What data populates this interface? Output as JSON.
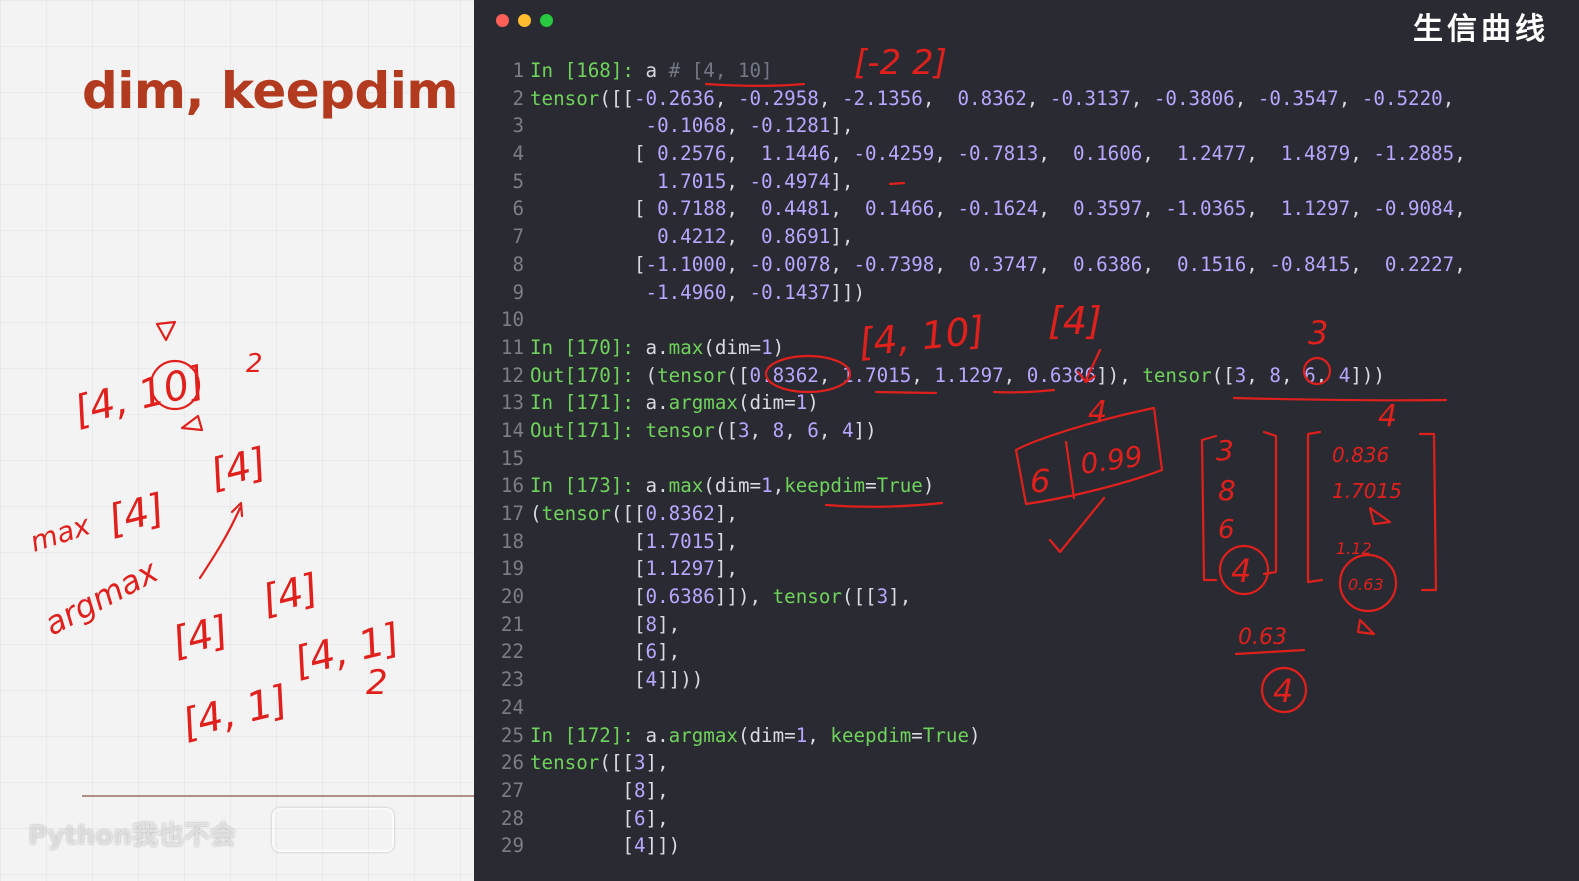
{
  "slide": {
    "title": "dim, keepdim",
    "watermark": "Python我也不会"
  },
  "window": {
    "brand": "生信曲线",
    "dot_colors": [
      "#ff5f57",
      "#febc2e",
      "#28c840"
    ]
  },
  "colors": {
    "prompt": "#6fd35b",
    "number": "#b9a6ff",
    "comment": "#737884",
    "ink": "#e0201c",
    "title": "#b23a1f"
  },
  "code_lines": [
    {
      "n": "1",
      "s": [
        [
          "p",
          "In [168]: "
        ],
        [
          "t",
          "a "
        ],
        [
          "c",
          "# [4, 10]"
        ]
      ]
    },
    {
      "n": "2",
      "s": [
        [
          "k",
          "tensor"
        ],
        [
          "t",
          "([["
        ],
        [
          "m",
          "-0.2636"
        ],
        [
          "t",
          ", "
        ],
        [
          "m",
          "-0.2958"
        ],
        [
          "t",
          ", "
        ],
        [
          "m",
          "-2.1356"
        ],
        [
          "t",
          ",  "
        ],
        [
          "m",
          "0.8362"
        ],
        [
          "t",
          ", "
        ],
        [
          "m",
          "-0.3137"
        ],
        [
          "t",
          ", "
        ],
        [
          "m",
          "-0.3806"
        ],
        [
          "t",
          ", "
        ],
        [
          "m",
          "-0.3547"
        ],
        [
          "t",
          ", "
        ],
        [
          "m",
          "-0.5220"
        ],
        [
          "t",
          ","
        ]
      ]
    },
    {
      "n": "3",
      "s": [
        [
          "t",
          "          "
        ],
        [
          "m",
          "-0.1068"
        ],
        [
          "t",
          ", "
        ],
        [
          "m",
          "-0.1281"
        ],
        [
          "t",
          "],"
        ]
      ]
    },
    {
      "n": "4",
      "s": [
        [
          "t",
          "         [ "
        ],
        [
          "m",
          "0.2576"
        ],
        [
          "t",
          ",  "
        ],
        [
          "m",
          "1.1446"
        ],
        [
          "t",
          ", "
        ],
        [
          "m",
          "-0.4259"
        ],
        [
          "t",
          ", "
        ],
        [
          "m",
          "-0.7813"
        ],
        [
          "t",
          ",  "
        ],
        [
          "m",
          "0.1606"
        ],
        [
          "t",
          ",  "
        ],
        [
          "m",
          "1.2477"
        ],
        [
          "t",
          ",  "
        ],
        [
          "m",
          "1.4879"
        ],
        [
          "t",
          ", "
        ],
        [
          "m",
          "-1.2885"
        ],
        [
          "t",
          ","
        ]
      ]
    },
    {
      "n": "5",
      "s": [
        [
          "t",
          "           "
        ],
        [
          "m",
          "1.7015"
        ],
        [
          "t",
          ", "
        ],
        [
          "m",
          "-0.4974"
        ],
        [
          "t",
          "],"
        ]
      ]
    },
    {
      "n": "6",
      "s": [
        [
          "t",
          "         [ "
        ],
        [
          "m",
          "0.7188"
        ],
        [
          "t",
          ",  "
        ],
        [
          "m",
          "0.4481"
        ],
        [
          "t",
          ",  "
        ],
        [
          "m",
          "0.1466"
        ],
        [
          "t",
          ", "
        ],
        [
          "m",
          "-0.1624"
        ],
        [
          "t",
          ",  "
        ],
        [
          "m",
          "0.3597"
        ],
        [
          "t",
          ", "
        ],
        [
          "m",
          "-1.0365"
        ],
        [
          "t",
          ",  "
        ],
        [
          "m",
          "1.1297"
        ],
        [
          "t",
          ", "
        ],
        [
          "m",
          "-0.9084"
        ],
        [
          "t",
          ","
        ]
      ]
    },
    {
      "n": "7",
      "s": [
        [
          "t",
          "           "
        ],
        [
          "m",
          "0.4212"
        ],
        [
          "t",
          ",  "
        ],
        [
          "m",
          "0.8691"
        ],
        [
          "t",
          "],"
        ]
      ]
    },
    {
      "n": "8",
      "s": [
        [
          "t",
          "         ["
        ],
        [
          "m",
          "-1.1000"
        ],
        [
          "t",
          ", "
        ],
        [
          "m",
          "-0.0078"
        ],
        [
          "t",
          ", "
        ],
        [
          "m",
          "-0.7398"
        ],
        [
          "t",
          ",  "
        ],
        [
          "m",
          "0.3747"
        ],
        [
          "t",
          ",  "
        ],
        [
          "m",
          "0.6386"
        ],
        [
          "t",
          ",  "
        ],
        [
          "m",
          "0.1516"
        ],
        [
          "t",
          ", "
        ],
        [
          "m",
          "-0.8415"
        ],
        [
          "t",
          ",  "
        ],
        [
          "m",
          "0.2227"
        ],
        [
          "t",
          ","
        ]
      ]
    },
    {
      "n": "9",
      "s": [
        [
          "t",
          "          "
        ],
        [
          "m",
          "-1.4960"
        ],
        [
          "t",
          ", "
        ],
        [
          "m",
          "-0.1437"
        ],
        [
          "t",
          "]])"
        ]
      ]
    },
    {
      "n": "10",
      "s": []
    },
    {
      "n": "11",
      "s": [
        [
          "p",
          "In [170]: "
        ],
        [
          "t",
          "a."
        ],
        [
          "f",
          "max"
        ],
        [
          "t",
          "(dim="
        ],
        [
          "m",
          "1"
        ],
        [
          "t",
          ")"
        ]
      ]
    },
    {
      "n": "12",
      "s": [
        [
          "p",
          "Out[170]: "
        ],
        [
          "t",
          "("
        ],
        [
          "k",
          "tensor"
        ],
        [
          "t",
          "(["
        ],
        [
          "m",
          "0.8362"
        ],
        [
          "t",
          ", "
        ],
        [
          "m",
          "1.7015"
        ],
        [
          "t",
          ", "
        ],
        [
          "m",
          "1.1297"
        ],
        [
          "t",
          ", "
        ],
        [
          "m",
          "0.6386"
        ],
        [
          "t",
          "]), "
        ],
        [
          "k",
          "tensor"
        ],
        [
          "t",
          "(["
        ],
        [
          "m",
          "3"
        ],
        [
          "t",
          ", "
        ],
        [
          "m",
          "8"
        ],
        [
          "t",
          ", "
        ],
        [
          "m",
          "6"
        ],
        [
          "t",
          ", "
        ],
        [
          "m",
          "4"
        ],
        [
          "t",
          "]))"
        ]
      ]
    },
    {
      "n": "13",
      "s": [
        [
          "p",
          "In [171]: "
        ],
        [
          "t",
          "a."
        ],
        [
          "f",
          "argmax"
        ],
        [
          "t",
          "(dim="
        ],
        [
          "m",
          "1"
        ],
        [
          "t",
          ")"
        ]
      ]
    },
    {
      "n": "14",
      "s": [
        [
          "p",
          "Out[171]: "
        ],
        [
          "k",
          "tensor"
        ],
        [
          "t",
          "(["
        ],
        [
          "m",
          "3"
        ],
        [
          "t",
          ", "
        ],
        [
          "m",
          "8"
        ],
        [
          "t",
          ", "
        ],
        [
          "m",
          "6"
        ],
        [
          "t",
          ", "
        ],
        [
          "m",
          "4"
        ],
        [
          "t",
          "])"
        ]
      ]
    },
    {
      "n": "15",
      "s": []
    },
    {
      "n": "16",
      "s": [
        [
          "p",
          "In [173]: "
        ],
        [
          "t",
          "a."
        ],
        [
          "f",
          "max"
        ],
        [
          "t",
          "(dim="
        ],
        [
          "m",
          "1"
        ],
        [
          "t",
          ","
        ],
        [
          "k",
          "keepdim"
        ],
        [
          "t",
          "="
        ],
        [
          "k",
          "True"
        ],
        [
          "t",
          ")"
        ]
      ]
    },
    {
      "n": "17",
      "s": [
        [
          "t",
          "("
        ],
        [
          "k",
          "tensor"
        ],
        [
          "t",
          "([["
        ],
        [
          "m",
          "0.8362"
        ],
        [
          "t",
          "],"
        ]
      ]
    },
    {
      "n": "18",
      "s": [
        [
          "t",
          "         ["
        ],
        [
          "m",
          "1.7015"
        ],
        [
          "t",
          "],"
        ]
      ]
    },
    {
      "n": "19",
      "s": [
        [
          "t",
          "         ["
        ],
        [
          "m",
          "1.1297"
        ],
        [
          "t",
          "],"
        ]
      ]
    },
    {
      "n": "20",
      "s": [
        [
          "t",
          "         ["
        ],
        [
          "m",
          "0.6386"
        ],
        [
          "t",
          "]]), "
        ],
        [
          "k",
          "tensor"
        ],
        [
          "t",
          "([["
        ],
        [
          "m",
          "3"
        ],
        [
          "t",
          "],"
        ]
      ]
    },
    {
      "n": "21",
      "s": [
        [
          "t",
          "         ["
        ],
        [
          "m",
          "8"
        ],
        [
          "t",
          "],"
        ]
      ]
    },
    {
      "n": "22",
      "s": [
        [
          "t",
          "         ["
        ],
        [
          "m",
          "6"
        ],
        [
          "t",
          "],"
        ]
      ]
    },
    {
      "n": "23",
      "s": [
        [
          "t",
          "         ["
        ],
        [
          "m",
          "4"
        ],
        [
          "t",
          "]]))"
        ]
      ]
    },
    {
      "n": "24",
      "s": []
    },
    {
      "n": "25",
      "s": [
        [
          "p",
          "In [172]: "
        ],
        [
          "t",
          "a."
        ],
        [
          "f",
          "argmax"
        ],
        [
          "t",
          "(dim="
        ],
        [
          "m",
          "1"
        ],
        [
          "t",
          ", "
        ],
        [
          "k",
          "keepdim"
        ],
        [
          "t",
          "="
        ],
        [
          "k",
          "True"
        ],
        [
          "t",
          ")"
        ]
      ]
    },
    {
      "n": "26",
      "s": [
        [
          "k",
          "tensor"
        ],
        [
          "t",
          "([["
        ],
        [
          "m",
          "3"
        ],
        [
          "t",
          "],"
        ]
      ]
    },
    {
      "n": "27",
      "s": [
        [
          "t",
          "        ["
        ],
        [
          "m",
          "8"
        ],
        [
          "t",
          "],"
        ]
      ]
    },
    {
      "n": "28",
      "s": [
        [
          "t",
          "        ["
        ],
        [
          "m",
          "6"
        ],
        [
          "t",
          "],"
        ]
      ]
    },
    {
      "n": "29",
      "s": [
        [
          "t",
          "        ["
        ],
        [
          "m",
          "4"
        ],
        [
          "t",
          "]])"
        ]
      ]
    }
  ],
  "annotations": {
    "slide": {
      "shape_a": "[4, 10]",
      "num_2_top": "2",
      "max": "max",
      "argmax": "argmax",
      "b1": "[4]",
      "b2": "[4]",
      "b3": "[4]",
      "b4": "[4]",
      "b5": "[4, 1]",
      "b6": "[4, 1]",
      "num_2_bottom": "2"
    },
    "terminal": {
      "range": "[-2  2]",
      "shape": "[4, 10]",
      "shape4": "[4]",
      "three": "3",
      "four_a": "4",
      "four_b": "4",
      "box_6": "6",
      "box_099": "0.99",
      "col_3": "3",
      "col_8": "8",
      "col_6": "6",
      "col_4": "4",
      "col_0836": "0.836",
      "col_17015": "1.7015",
      "col_112": "1.12",
      "col_063": "0.63",
      "frac_063": "0.63",
      "frac_4": "4"
    }
  }
}
